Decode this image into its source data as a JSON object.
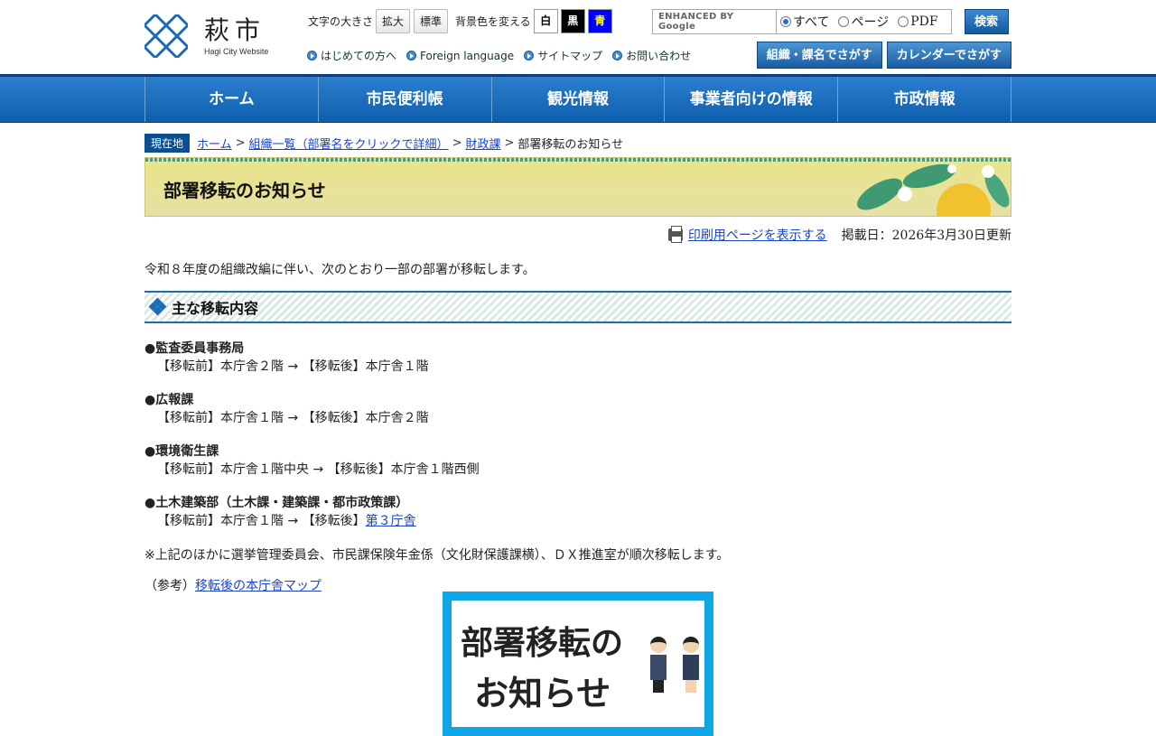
{
  "header": {
    "logo_jp": "萩市",
    "logo_en": "Hagi City Website",
    "font_size_label": "文字の大きさ",
    "font_size_buttons": [
      "拡大",
      "標準"
    ],
    "bg_color_label": "背景色を変える",
    "bg_color_buttons": [
      "白",
      "黒",
      "青"
    ],
    "sublinks": [
      "はじめての方へ",
      "Foreign language",
      "サイトマップ",
      "お問い合わせ"
    ],
    "search": {
      "placeholder": "ENHANCED BY Google",
      "radio_options": [
        "すべて",
        "ページ",
        "PDF"
      ],
      "selected": "すべて",
      "button": "検索"
    },
    "big_buttons": [
      "組織・課名でさがす",
      "カレンダーでさがす"
    ]
  },
  "nav": [
    "ホーム",
    "市民便利帳",
    "観光情報",
    "事業者向けの情報",
    "市政情報"
  ],
  "breadcrumb": {
    "label": "現在地",
    "items": [
      "ホーム",
      "組織一覧（部署名をクリックで詳細）",
      "財政課"
    ],
    "current": "部署移転のお知らせ"
  },
  "page": {
    "title": "部署移転のお知らせ",
    "print_link": "印刷用ページを表示する",
    "date": "掲載日：2026年3月30日更新",
    "intro": "令和８年度の組織改編に伴い、次のとおり一部の部署が移転します。",
    "section_title": "主な移転内容",
    "items": [
      {
        "name": "●監査委員事務局",
        "detail": "【移転前】本庁舎２階 → 【移転後】本庁舎１階"
      },
      {
        "name": "●広報課",
        "detail": "【移転前】本庁舎１階 → 【移転後】本庁舎２階"
      },
      {
        "name": "●環境衛生課",
        "detail": "【移転前】本庁舎１階中央 → 【移転後】本庁舎１階西側"
      },
      {
        "name": "●土木建築部（土木課・建築課・都市政策課）",
        "detail_prefix": "【移転前】本庁舎１階 → 【移転後】",
        "detail_link": "第３庁舎"
      }
    ],
    "note": "※上記のほかに選挙管理委員会、市民課保険年金係（文化財保護課横）、ＤＸ推進室が順次移転します。",
    "ref_prefix": "（参考）",
    "ref_link": "移転後の本庁舎マップ",
    "banner_line1": "部署移転の",
    "banner_line2": "お知らせ"
  },
  "colors": {
    "brand_blue": "#1f6bb5",
    "nav_blue": "#1a6bbd",
    "banner_border": "#0fa6e6",
    "title_bg": "#e8e28e"
  }
}
